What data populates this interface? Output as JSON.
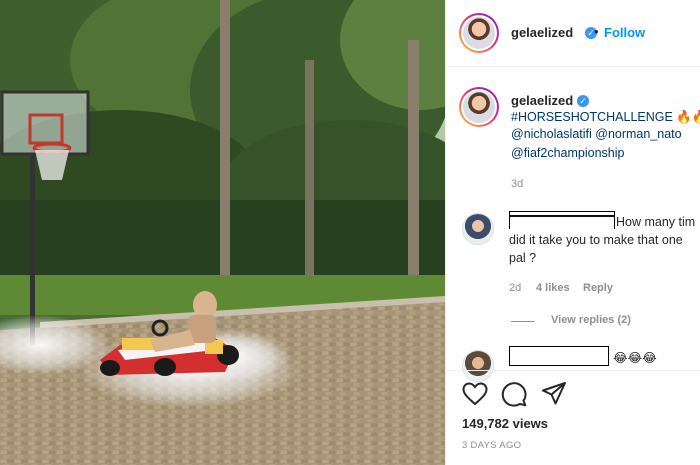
{
  "post": {
    "author": "gelaelized",
    "dot": "•",
    "follow_label": "Follow",
    "caption": {
      "author": "gelaelized",
      "hashtag": "#HORSESHOTCHALLENGE",
      "emojis": "🔥🔥",
      "mention_line_1": "@nicholaslatifi @norman_nato",
      "mention_line_2": "@fiaf2championship",
      "time": "3d"
    },
    "comments": [
      {
        "text_line_1": "How many tim",
        "text_line_2": "did it take you to make that one",
        "text_line_3": "pal ?",
        "time": "2d",
        "likes": "4 likes",
        "reply_label": "Reply",
        "view_replies": "View replies (2)"
      },
      {
        "emojis": "😂😂😂"
      }
    ],
    "views": "149,782 views",
    "posted": "3 DAYS AGO"
  },
  "icons": {
    "like": "heart-icon",
    "comment": "comment-icon",
    "share": "share-icon",
    "verified": "verified-badge-icon"
  },
  "colors": {
    "link": "#00376b",
    "follow": "#0095f6",
    "verified": "#3897f0",
    "muted": "#8e8e8e"
  }
}
